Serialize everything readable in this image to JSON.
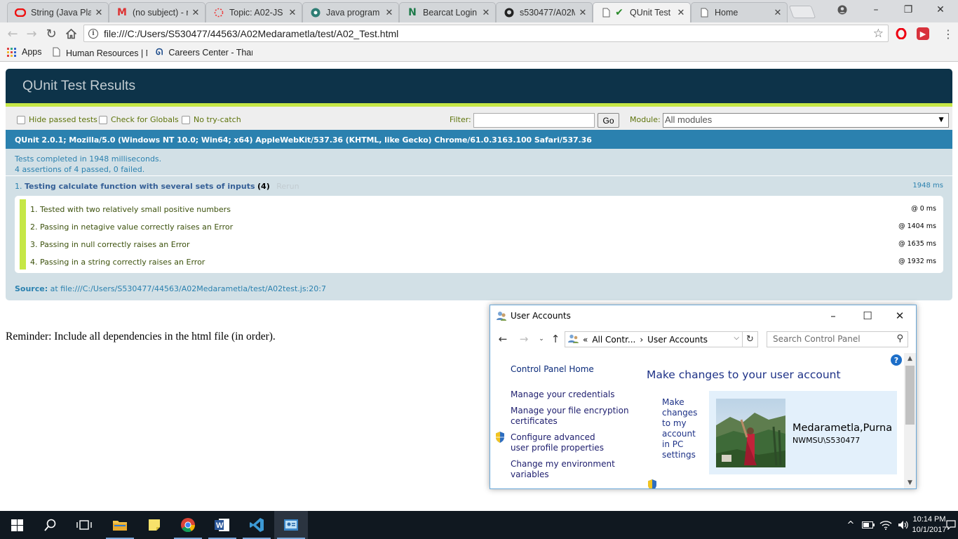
{
  "browser": {
    "tabs": [
      {
        "title": "String (Java Pla",
        "icon": "oracle-icon"
      },
      {
        "title": "(no subject) - r",
        "icon": "gmail-icon"
      },
      {
        "title": "Topic: A02-JS",
        "icon": "loading-icon"
      },
      {
        "title": "Java program t",
        "icon": "site-icon"
      },
      {
        "title": "Bearcat Login",
        "icon": "bearcat-icon"
      },
      {
        "title": "s530477/A02M",
        "icon": "github-icon"
      },
      {
        "title": "QUnit Test",
        "icon": "check-icon"
      },
      {
        "title": "Home",
        "icon": "page-icon"
      }
    ],
    "active_tab_index": 6,
    "url": "file:///C:/Users/S530477/44563/A02Medarametla/test/A02_Test.html",
    "bookmarks": {
      "apps_label": "Apps",
      "human_resources": "Human Resources | N",
      "careers": "Careers Center - Than"
    }
  },
  "qunit": {
    "title": "QUnit Test Results",
    "toolbar": {
      "hide_passed": "Hide passed tests",
      "check_globals": "Check for Globals",
      "no_try_catch": "No try-catch",
      "filter_label": "Filter:",
      "go_label": "Go",
      "module_label": "Module:",
      "module_value": "All modules"
    },
    "user_agent": "QUnit 2.0.1; Mozilla/5.0 (Windows NT 10.0; Win64; x64) AppleWebKit/537.36 (KHTML, like Gecko) Chrome/61.0.3163.100 Safari/537.36",
    "result_line1": "Tests completed in 1948 milliseconds.",
    "result_line2": "4 assertions of 4 passed, 0 failed.",
    "test": {
      "number": "1.",
      "name": "Testing calculate function with several sets of inputs",
      "count": "(4)",
      "rerun": "Rerun",
      "runtime": "1948 ms",
      "assertions": [
        {
          "text": "1. Tested with two relatively small positive numbers",
          "time": "@ 0 ms"
        },
        {
          "text": "2. Passing in netagive value correctly raises an Error",
          "time": "@ 1404 ms"
        },
        {
          "text": "3. Passing in null correctly raises an Error",
          "time": "@ 1635 ms"
        },
        {
          "text": "4. Passing in a string correctly raises an Error",
          "time": "@ 1932 ms"
        }
      ],
      "source_label": "Source:",
      "source_value": "at file:///C:/Users/S530477/44563/A02Medarametla/test/A02test.js:20:7"
    }
  },
  "reminder": "Reminder: Include all dependencies in the html file (in order).",
  "user_accounts": {
    "title": "User Accounts",
    "breadcrumb_root": "All Contr...",
    "breadcrumb_current": "User Accounts",
    "search_placeholder": "Search Control Panel",
    "links": {
      "home": "Control Panel Home",
      "credentials": "Manage your credentials",
      "encryption": "Manage your file encryption certificates",
      "advanced_profile": "Configure advanced user profile properties",
      "environment": "Change my environment variables"
    },
    "heading": "Make changes to your user account",
    "pc_settings_link": "Make changes to my account in PC settings",
    "user_name": "Medarametla,Purna",
    "user_account": "NWMSU\\S530477"
  },
  "taskbar": {
    "time": "10:14 PM",
    "date": "10/1/2017"
  }
}
